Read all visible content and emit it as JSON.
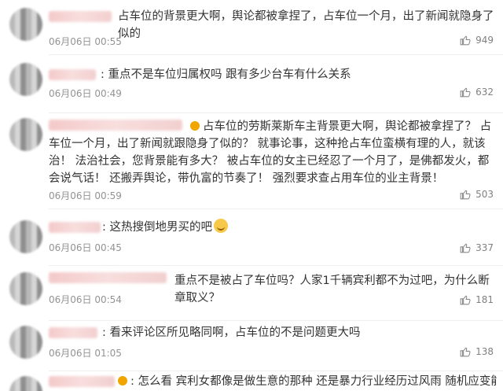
{
  "comments": [
    {
      "text": "占车位的背景更大啊，舆论都被拿捏了，占车位一个月，出了新闻就隐身了似的",
      "date": "06月06日 00:55",
      "likes": "949"
    },
    {
      "text": "重点不是车位归属权吗 跟有多少台车有什么关系",
      "date": "06月06日 00:49",
      "likes": "632"
    },
    {
      "text": "占车位的劳斯莱斯车主背景更大啊，舆论都被拿捏了？ 占车位一个月，出了新闻就跟隐身了似的？ 就事论事，这种抢占车位蛮横有理的人，就该治！ 法治社会，您背景能有多大？ 被占车位的女主已经忍了一个月了，是佛都发火，都会说气话！ 还搬弄舆论，带仇富的节奏了！ 强烈要求查占用车位的业主背景！",
      "date": "06月06日 00:59",
      "likes": "503"
    },
    {
      "text": "这热搜倒地男买的吧",
      "date": "06月06日 00:45",
      "likes": "337"
    },
    {
      "text": "重点不是被占了车位吗？人家1千辆宾利都不为过吧，为什么断章取义？",
      "date": "06月06日 00:54",
      "likes": "181"
    },
    {
      "text": "看来评论区所见略同啊，占车位的不是问题更大吗",
      "date": "06月06日 01:05",
      "likes": "138"
    },
    {
      "text": "怎么看 宾利女都像是做生意的那种 还是暴力行业经历过风雨 随机应变能力巨强 不像",
      "date": "",
      "likes": ""
    }
  ],
  "icons": {
    "like": "thumbs-up-icon",
    "emoji": "grin-emoji-icon"
  }
}
